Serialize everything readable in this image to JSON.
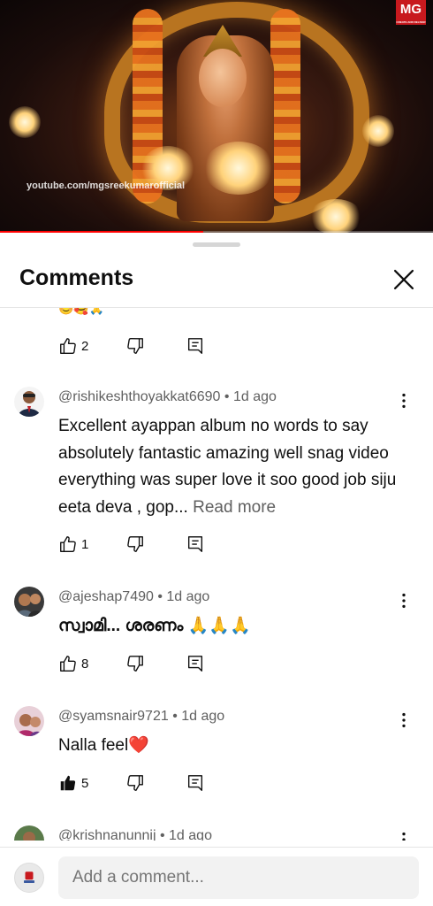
{
  "video": {
    "watermark": "youtube.com/mgsreekumarofficial",
    "logo_text": "MG",
    "logo_subtext": "CREATE AND DELIVER",
    "progress_fraction": 0.47,
    "progress_color": "#ff0000"
  },
  "sheet": {
    "title": "Comments",
    "close_icon": "close-icon"
  },
  "previous_comment": {
    "emoji_tail": "😊🥰🙏",
    "likes": "2"
  },
  "comments": [
    {
      "author": "@rishikeshthoyakkat6690",
      "time": "1d ago",
      "text": "Excellent ayappan album no words to say absolutely fantastic amazing well snag video everything was super love it soo good job siju eeta deva , gop...",
      "read_more": "Read more",
      "likes": "1",
      "liked": false
    },
    {
      "author": "@ajeshap7490",
      "time": "1d ago",
      "text": "സ്വാമി... ശരണം 🙏🙏🙏",
      "likes": "8",
      "liked": false
    },
    {
      "author": "@syamsnair9721",
      "time": "1d ago",
      "text": "Nalla feel❤️",
      "likes": "5",
      "liked": true
    },
    {
      "author": "@krishnanunnij",
      "time": "1d ago"
    }
  ],
  "add_comment": {
    "placeholder": "Add a comment..."
  },
  "colors": {
    "secondary_text": "#606060",
    "divider": "#e5e5e5"
  }
}
